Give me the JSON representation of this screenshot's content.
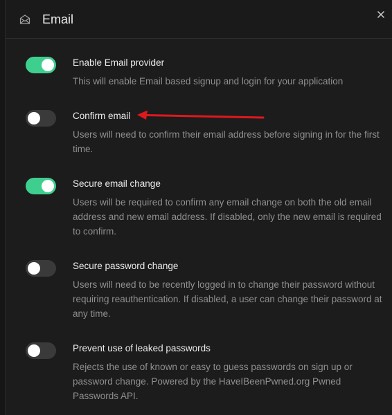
{
  "header": {
    "title": "Email",
    "icon": "mail-open-icon",
    "close_icon": "close-icon"
  },
  "settings": [
    {
      "label": "Enable Email provider",
      "description": "This will enable Email based signup and login for your application",
      "enabled": true
    },
    {
      "label": "Confirm email",
      "description": "Users will need to confirm their email address before signing in for the first time.",
      "enabled": false
    },
    {
      "label": "Secure email change",
      "description": "Users will be required to confirm any email change on both the old email address and new email address. If disabled, only the new email is required to confirm.",
      "enabled": true
    },
    {
      "label": "Secure password change",
      "description": "Users will need to be recently logged in to change their password without requiring reauthentication. If disabled, a user can change their password at any time.",
      "enabled": false
    },
    {
      "label": "Prevent use of leaked passwords",
      "description": "Rejects the use of known or easy to guess passwords on sign up or password change. Powered by the HaveIBeenPwned.org Pwned Passwords API.",
      "enabled": false
    }
  ],
  "colors": {
    "toggle_on": "#3ecf8e",
    "toggle_off": "#3a3a3a",
    "annotation_arrow": "#e0181e"
  }
}
